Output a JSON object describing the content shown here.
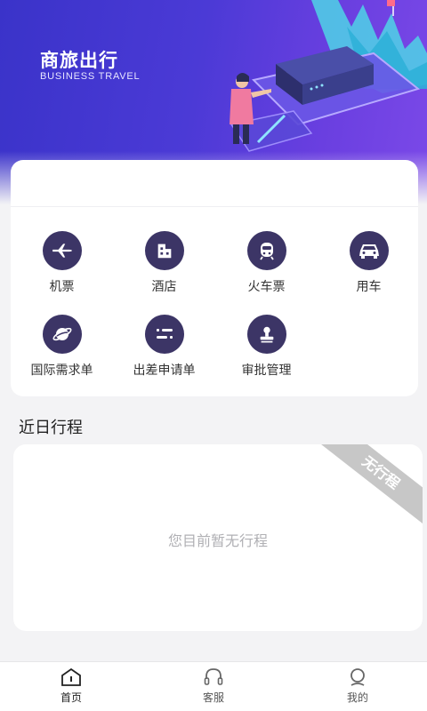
{
  "banner": {
    "title": "商旅出行",
    "subtitle": "BUSINESS TRAVEL"
  },
  "services": [
    {
      "label": "机票",
      "icon": "airplane-icon"
    },
    {
      "label": "酒店",
      "icon": "building-icon"
    },
    {
      "label": "火车票",
      "icon": "train-icon"
    },
    {
      "label": "用车",
      "icon": "car-icon"
    },
    {
      "label": "国际需求单",
      "icon": "planet-icon"
    },
    {
      "label": "出差申请单",
      "icon": "toggle-icon"
    },
    {
      "label": "审批管理",
      "icon": "stamp-icon"
    }
  ],
  "trips": {
    "section_title": "近日行程",
    "ribbon": "无行程",
    "empty_text": "您目前暂无行程"
  },
  "nav": [
    {
      "label": "首页",
      "icon": "home-icon",
      "active": true
    },
    {
      "label": "客服",
      "icon": "headset-icon",
      "active": false
    },
    {
      "label": "我的",
      "icon": "profile-icon",
      "active": false
    }
  ],
  "colors": {
    "banner_start": "#3a33c9",
    "banner_end": "#7b49e8",
    "icon_circle": "#3c3566",
    "ribbon": "#c7c7c7"
  }
}
